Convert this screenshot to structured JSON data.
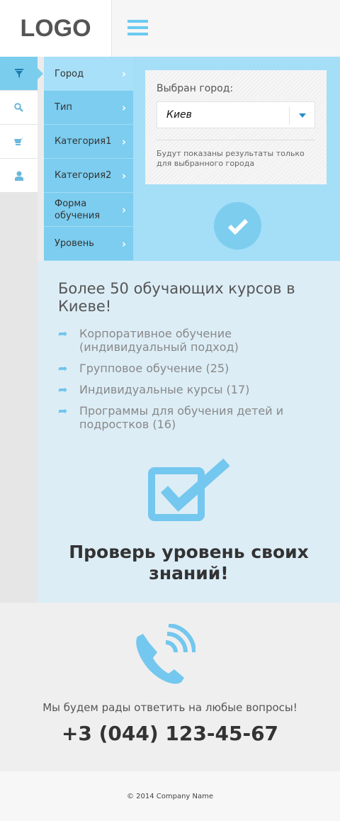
{
  "header": {
    "logo": "LOGO"
  },
  "sidebar_icons": [
    "filter-icon",
    "search-icon",
    "cart-icon",
    "user-icon"
  ],
  "menu": [
    {
      "label": "Город"
    },
    {
      "label": "Тип"
    },
    {
      "label": "Категория1"
    },
    {
      "label": "Категория2"
    },
    {
      "label": "Форма обучения"
    },
    {
      "label": "Уровень"
    }
  ],
  "city": {
    "label": "Выбран город:",
    "value": "Киев",
    "note": "Будут показаны результаты только для выбранного города"
  },
  "info": {
    "headline": "Более 50 обучающих курсов в Киеве!",
    "items": [
      "Корпоративное обучение (индивидуальный подход)",
      "Групповое обучение (25)",
      "Индивидуальные курсы (17)",
      "Программы для обучения детей и подростков (16)"
    ],
    "test_title": "Проверь уровень своих знаний!"
  },
  "contact": {
    "text": "Мы будем рады ответить на любые вопросы!",
    "phone": "+3 (044) 123-45-67"
  },
  "footer": {
    "copyright": "© 2014 Company Name"
  },
  "colors": {
    "accent": "#7ccdef",
    "accent_light": "#a5def7",
    "panel": "#dcedf6"
  }
}
